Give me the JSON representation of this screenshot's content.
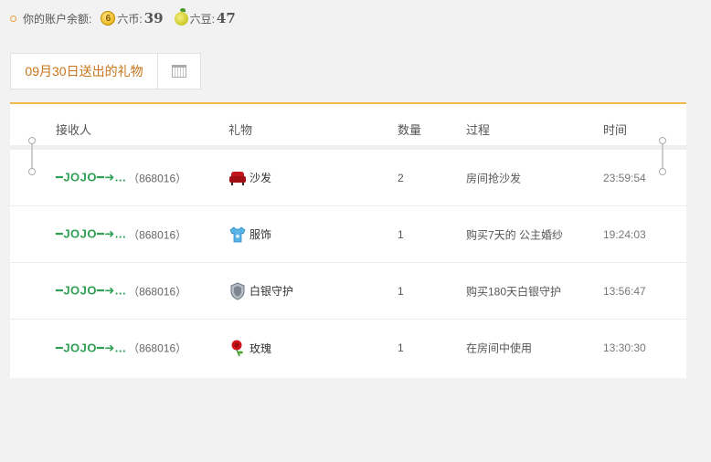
{
  "balance": {
    "label": "你的账户余额:",
    "coin_label": "六币:",
    "coin_value": "39",
    "coin_glyph": "6",
    "bean_label": "六豆:",
    "bean_value": "47"
  },
  "date_filter": {
    "label": "09月30日送出的礼物"
  },
  "table": {
    "headers": {
      "receiver": "接收人",
      "gift": "礼物",
      "count": "数量",
      "process": "过程",
      "time": "时间"
    },
    "rows": [
      {
        "nick": "━JOJO━➜...",
        "id": "（868016）",
        "gift": "沙发",
        "gift_icon": "sofa-icon",
        "count": "2",
        "process": "房间抢沙发",
        "time": "23:59:54"
      },
      {
        "nick": "━JOJO━➜...",
        "id": "（868016）",
        "gift": "服饰",
        "gift_icon": "clothing-icon",
        "count": "1",
        "process": "购买7天的 公主婚纱",
        "time": "19:24:03"
      },
      {
        "nick": "━JOJO━➜...",
        "id": "（868016）",
        "gift": "白银守护",
        "gift_icon": "silver-shield-icon",
        "count": "1",
        "process": "购买180天白银守护",
        "time": "13:56:47"
      },
      {
        "nick": "━JOJO━➜...",
        "id": "（868016）",
        "gift": "玫瑰",
        "gift_icon": "rose-icon",
        "count": "1",
        "process": "在房间中使用",
        "time": "13:30:30"
      }
    ]
  },
  "colors": {
    "accent": "#f0b94c",
    "nick": "#2ea053",
    "date": "#c8741a"
  }
}
